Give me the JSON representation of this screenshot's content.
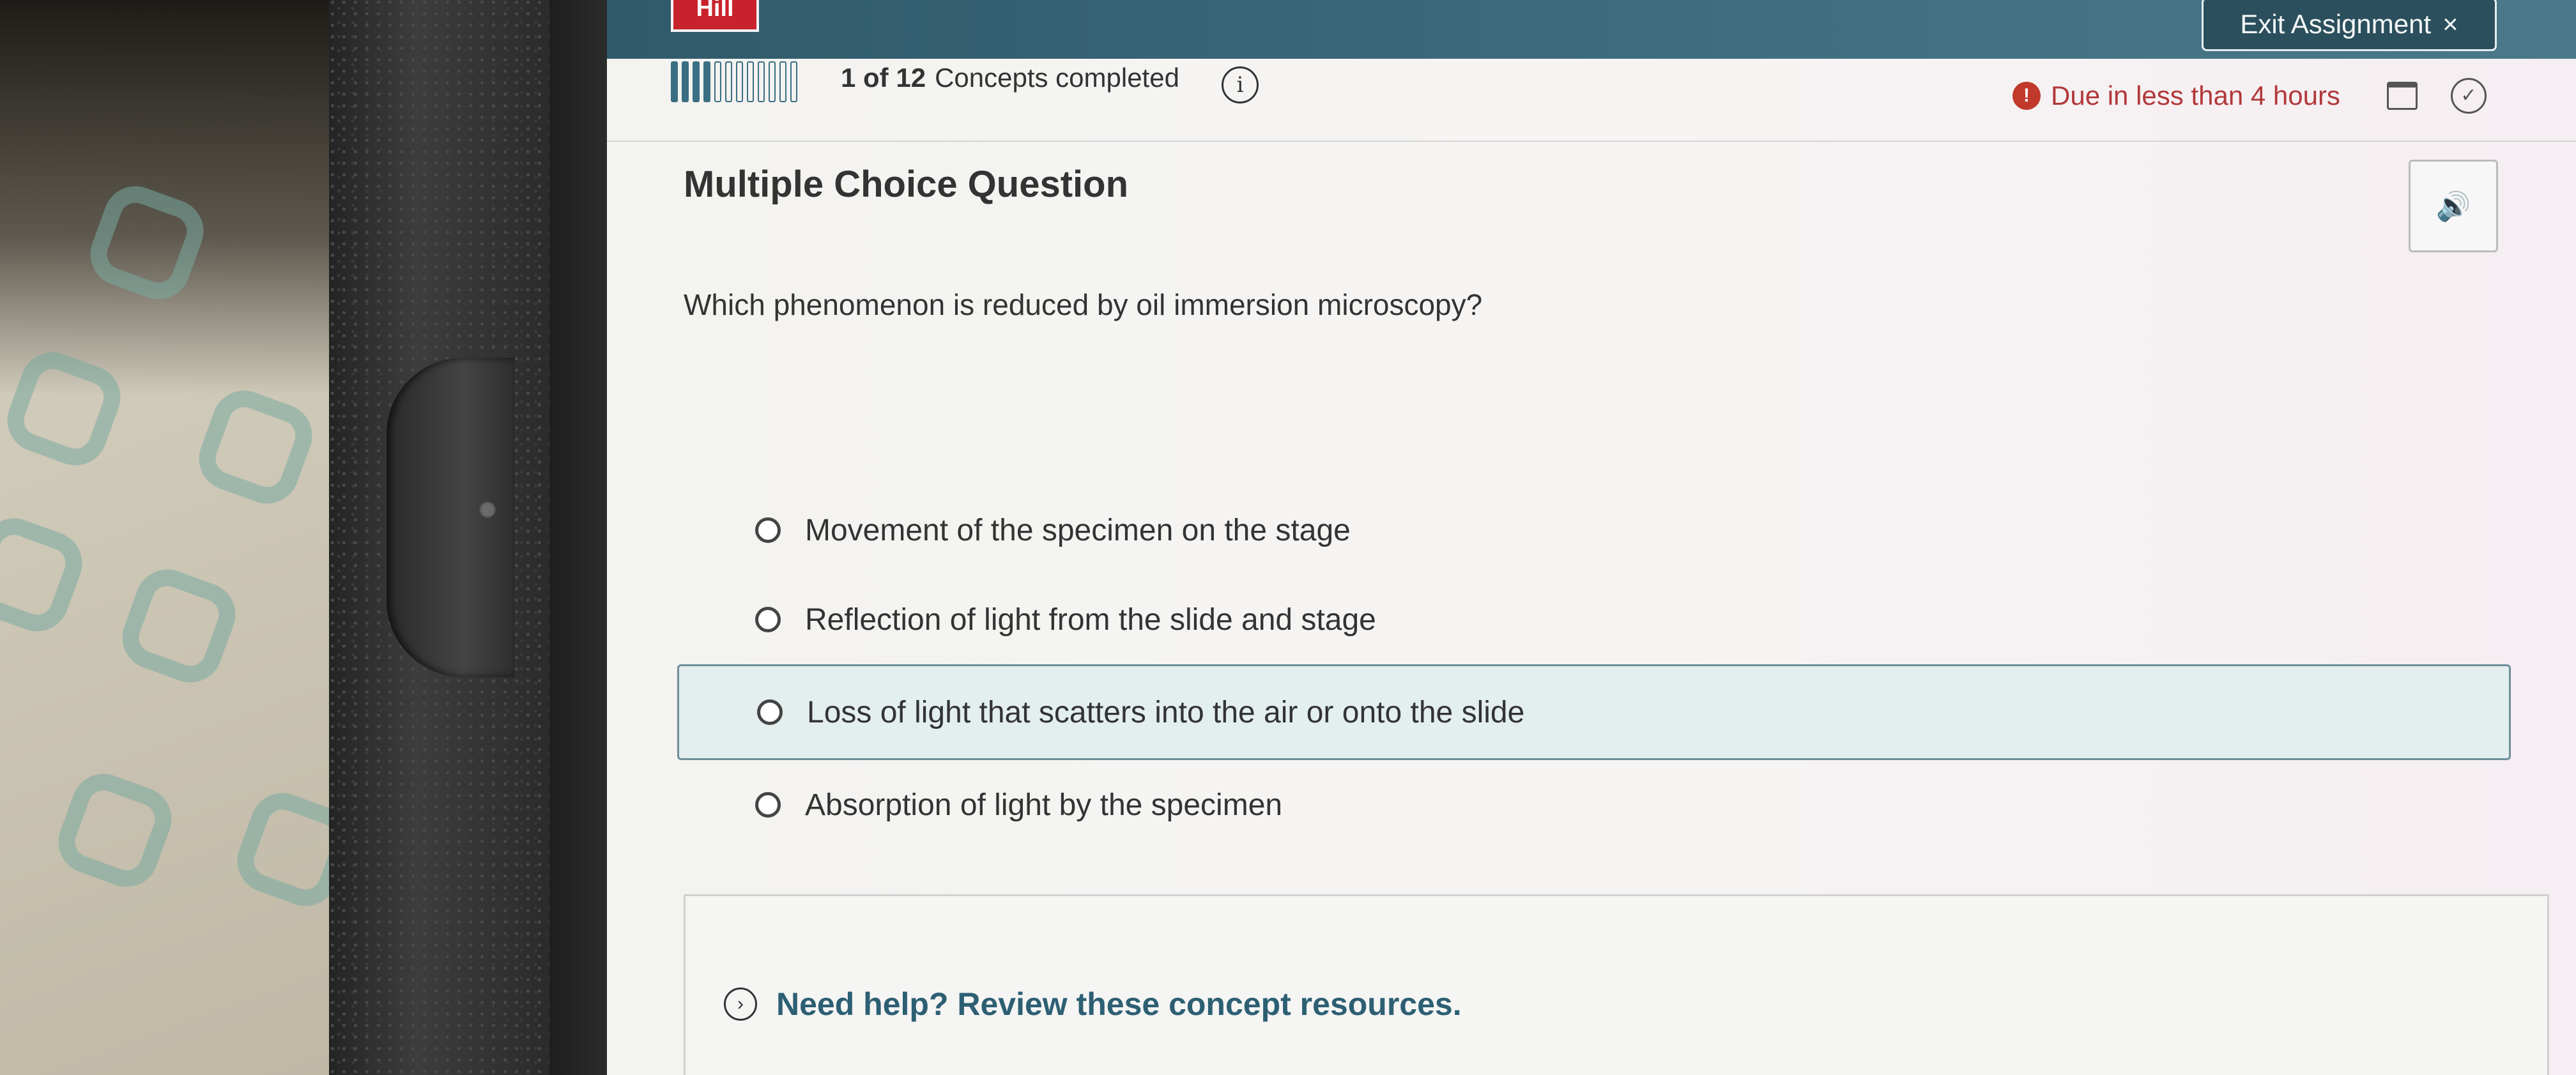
{
  "header": {
    "logo_text": "Hill",
    "exit_label": "Exit Assignment",
    "exit_icon": "×"
  },
  "progress": {
    "completed": 1,
    "total": 12,
    "count_text": "1 of 12",
    "label": "Concepts completed",
    "info_icon": "i"
  },
  "due": {
    "alert_icon": "!",
    "text": "Due in less than 4 hours"
  },
  "question": {
    "type_label": "Multiple Choice Question",
    "text": "Which phenomenon is reduced by oil immersion microscopy?",
    "audio_icon": "🔊"
  },
  "options": [
    {
      "label": "Movement of the specimen on the stage",
      "highlighted": false
    },
    {
      "label": "Reflection of light from the slide and stage",
      "highlighted": false
    },
    {
      "label": "Loss of light that scatters into the air or onto the slide",
      "highlighted": true
    },
    {
      "label": "Absorption of light by the specimen",
      "highlighted": false
    }
  ],
  "help": {
    "icon": "›",
    "text": "Need help? Review these concept resources."
  },
  "colors": {
    "topbar": "#3f6f80",
    "accent": "#3a6e82",
    "due": "#b2383a",
    "help_link": "#2d5f73",
    "highlight_bg": "#e3eeef"
  }
}
